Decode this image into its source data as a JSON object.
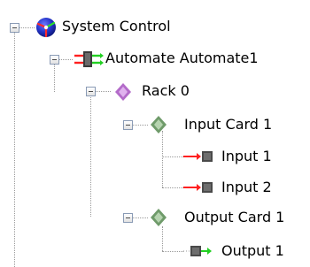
{
  "tree": {
    "system": {
      "label": "System Control",
      "icon": "globe-icon"
    },
    "automate": {
      "label": "Automate Automate1",
      "icon": "automate-icon"
    },
    "rack": {
      "label": "Rack 0",
      "icon": "rack-icon",
      "color": "#b36bc9"
    },
    "input_card": {
      "label": "Input Card 1",
      "icon": "card-icon",
      "color": "#6f9b6a"
    },
    "inputs": [
      {
        "label": "Input 1",
        "icon": "input-port-icon"
      },
      {
        "label": "Input 2",
        "icon": "input-port-icon"
      }
    ],
    "output_card": {
      "label": "Output Card 1",
      "icon": "card-icon",
      "color": "#6f9b6a"
    },
    "outputs": [
      {
        "label": "Output 1",
        "icon": "output-port-icon"
      }
    ]
  }
}
